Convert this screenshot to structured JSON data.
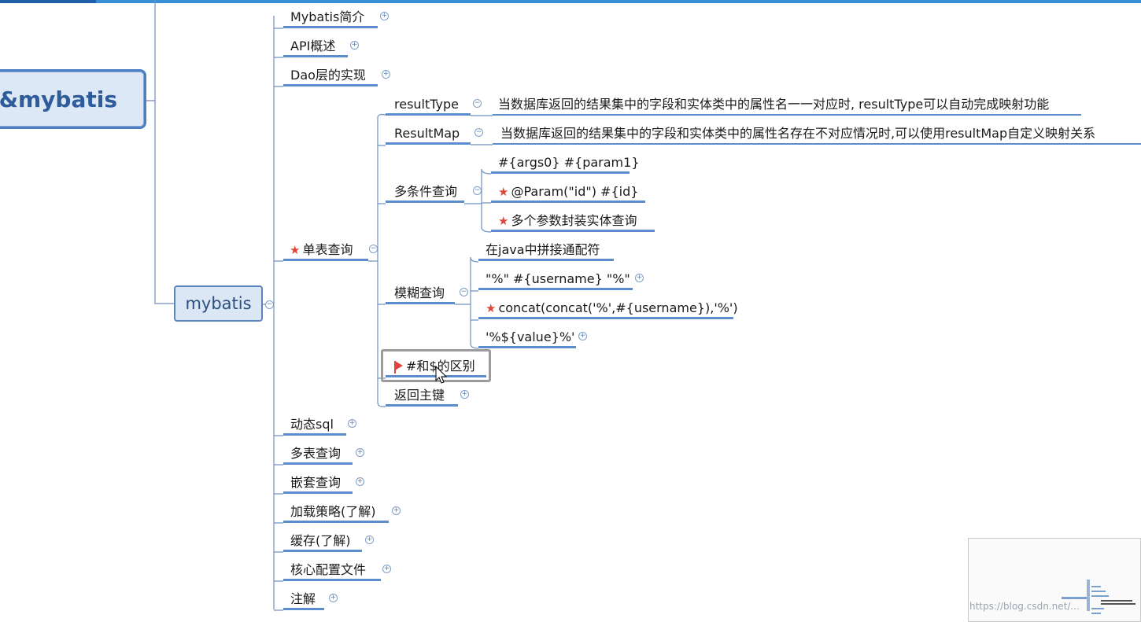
{
  "root": {
    "label": "&mybatis"
  },
  "central": {
    "label": "mybatis"
  },
  "level1": [
    {
      "label": "Mybatis简介"
    },
    {
      "label": "API概述"
    },
    {
      "label": "Dao层的实现"
    },
    {
      "label": "单表查询"
    },
    {
      "label": "动态sql"
    },
    {
      "label": "多表查询"
    },
    {
      "label": "嵌套查询"
    },
    {
      "label": "加载策略(了解)"
    },
    {
      "label": "缓存(了解)"
    },
    {
      "label": "核心配置文件"
    },
    {
      "label": "注解"
    }
  ],
  "single_table": {
    "children": [
      {
        "label": "resultType",
        "desc": "当数据库返回的结果集中的字段和实体类中的属性名一一对应时, resultType可以自动完成映射功能"
      },
      {
        "label": "ResultMap",
        "desc": "当数据库返回的结果集中的字段和实体类中的属性名存在不对应情况时,可以使用resultMap自定义映射关系"
      },
      {
        "label": "多条件查询",
        "items": [
          "#{args0} #{param1}",
          "@Param(\"id\")  #{id}",
          "多个参数封装实体查询"
        ]
      },
      {
        "label": "模糊查询",
        "items": [
          "在java中拼接通配符",
          "\"%\" #{username} \"%\"",
          "concat(concat('%',#{username}),'%')",
          "'%${value}%'"
        ]
      },
      {
        "label": "#和$的区别"
      },
      {
        "label": "返回主键"
      }
    ]
  },
  "watermark": "https://blog.csdn.net/..."
}
